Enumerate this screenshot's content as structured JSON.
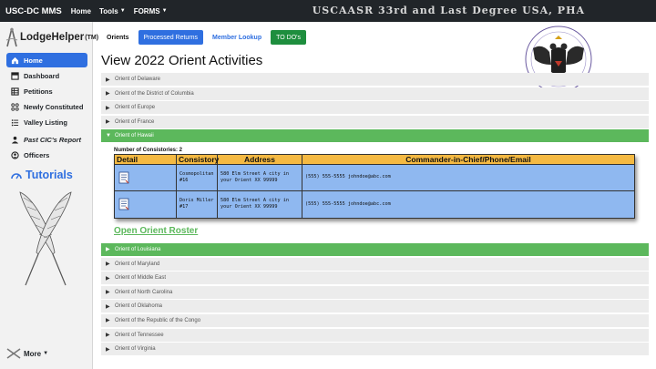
{
  "topbar": {
    "brand": "USC-DC MMS",
    "nav": [
      {
        "label": "Home",
        "caret": false
      },
      {
        "label": "Tools",
        "caret": true
      },
      {
        "label": "FORMS",
        "caret": true
      }
    ],
    "banner": "USCAASR 33rd and Last Degree USA, PHA"
  },
  "sidebar": {
    "logo_text": "LodgeHelper",
    "logo_tm": "(TM)",
    "items": [
      {
        "label": "Home",
        "icon": "home-icon",
        "active": true
      },
      {
        "label": "Dashboard",
        "icon": "dashboard-icon",
        "active": false
      },
      {
        "label": "Petitions",
        "icon": "table-icon",
        "active": false
      },
      {
        "label": "Newly Constituted",
        "icon": "network-icon",
        "active": false
      },
      {
        "label": "Valley Listing",
        "icon": "list-icon",
        "active": false
      },
      {
        "label": "Past CIC's Report",
        "icon": "person-icon",
        "active": false
      },
      {
        "label": "Officers",
        "icon": "people-icon",
        "active": false
      }
    ],
    "tutorials": "Tutorials",
    "more": "More"
  },
  "main": {
    "tabs": {
      "orients": "Orients",
      "processed": "Processed Returns",
      "member_lookup": "Member Lookup",
      "todo": "TO DO's"
    },
    "title": "View 2022 Orient Activities",
    "orients_before": [
      "Orient of Delaware",
      "Orient of the District of Columbia",
      "Orient of Europe",
      "Orient of France"
    ],
    "open_orient": "Orient of Hawaii",
    "consistory_count": "Number of Consistories: 2",
    "table_headers": {
      "detail": "Detail",
      "consistory": "Consistory",
      "address": "Address",
      "commander": "Commander-in-Chief/Phone/Email"
    },
    "consistories": [
      {
        "name": "Cosmopolitan #16",
        "address": "580 Elm Street A city in your Orient XX 99999",
        "contact": "(555) 555-5555 johndoe@abc.com"
      },
      {
        "name": "Doris Miller #17",
        "address": "580 Elm Street A city in your Orient XX 99999",
        "contact": "(555) 555-5555 johndoe@abc.com"
      }
    ],
    "roster_link": "Open Orient Roster",
    "orients_after": [
      {
        "label": "Orient of Louisiana",
        "highlight": true
      },
      {
        "label": "Orient of Maryland",
        "highlight": false
      },
      {
        "label": "Orient of Middle East",
        "highlight": false
      },
      {
        "label": "Orient of North Carolina",
        "highlight": false
      },
      {
        "label": "Orient of Oklahoma",
        "highlight": false
      },
      {
        "label": "Orient of the Republic of the Congo",
        "highlight": false
      },
      {
        "label": "Orient of Tennessee",
        "highlight": false
      },
      {
        "label": "Orient of Virginia",
        "highlight": false
      }
    ]
  },
  "colors": {
    "accent_blue": "#2f6fe0",
    "open_green": "#5cb85c",
    "table_header": "#f4b942",
    "table_row": "#8fb8f0"
  }
}
